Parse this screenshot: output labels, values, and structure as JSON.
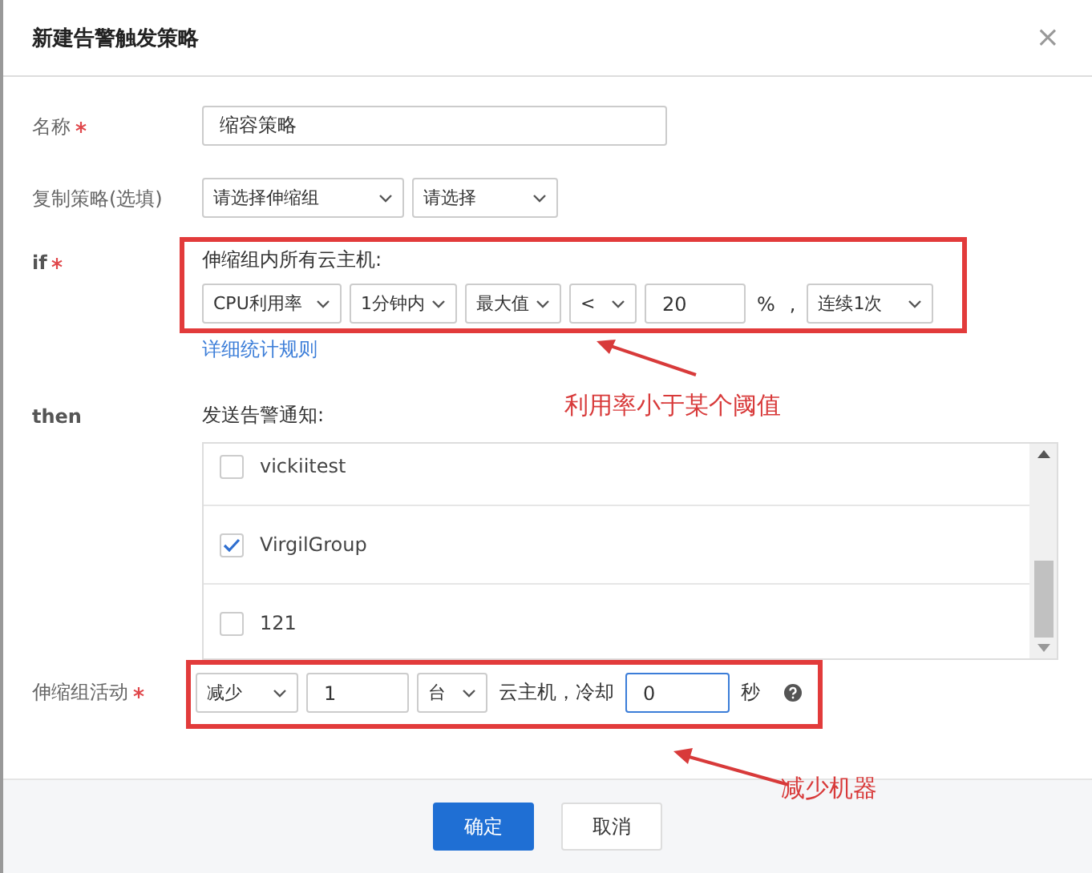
{
  "dialog": {
    "title": "新建告警触发策略",
    "close": "×"
  },
  "form": {
    "name": {
      "label": "名称",
      "required": true,
      "value": "缩容策略"
    },
    "copy": {
      "label": "复制策略(选填)",
      "selects": [
        "请选择伸缩组",
        "请选择"
      ]
    },
    "if": {
      "label": "if",
      "required": true,
      "caption": "伸缩组内所有云主机:",
      "controls": [
        {
          "kind": "select",
          "value": "CPU利用率"
        },
        {
          "kind": "select",
          "value": "1分钟内"
        },
        {
          "kind": "select",
          "value": "最大值"
        },
        {
          "kind": "select",
          "value": "<"
        },
        {
          "kind": "input",
          "value": "20"
        },
        {
          "kind": "text",
          "value": "%"
        },
        {
          "kind": "text",
          "value": ","
        },
        {
          "kind": "select",
          "value": "连续1次"
        }
      ],
      "link": "详细统计规则"
    },
    "then": {
      "label": "then",
      "caption": "发送告警通知:",
      "items": [
        {
          "label": "vickiitest",
          "checked": false
        },
        {
          "label": "VirgilGroup",
          "checked": true
        },
        {
          "label": "121",
          "checked": false
        }
      ]
    },
    "activity": {
      "label": "伸缩组活动",
      "required": true,
      "controls": [
        {
          "kind": "select",
          "value": "减少"
        },
        {
          "kind": "input",
          "value": "1",
          "focused": false
        },
        {
          "kind": "select",
          "value": "台"
        },
        {
          "kind": "text",
          "value": "云主机，冷却"
        },
        {
          "kind": "input",
          "value": "0",
          "focused": true
        },
        {
          "kind": "text",
          "value": "秒"
        },
        {
          "kind": "help"
        }
      ]
    }
  },
  "annotations": [
    "利用率小于某个阈值",
    "减少机器"
  ],
  "buttons": [
    {
      "label": "确定",
      "primary": true
    },
    {
      "label": "取消",
      "primary": false
    }
  ]
}
